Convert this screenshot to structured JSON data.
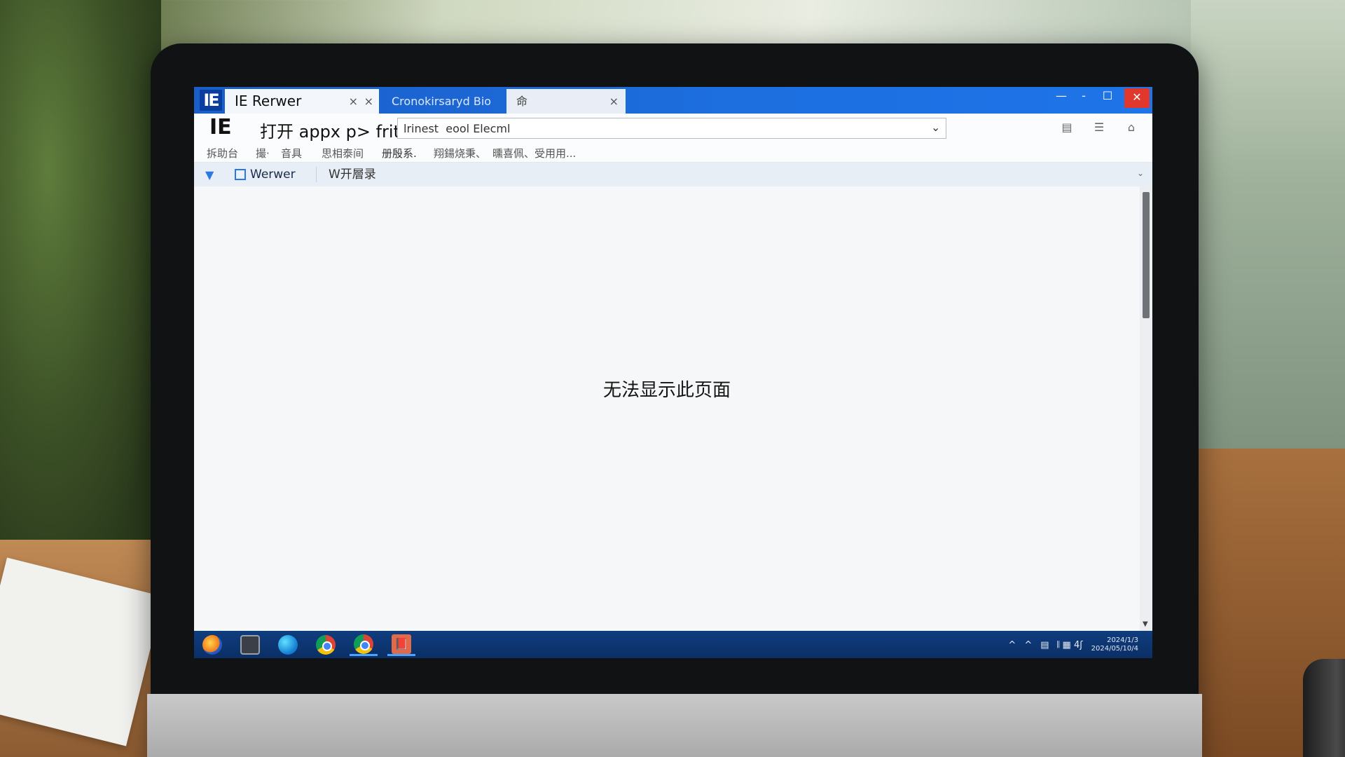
{
  "browser": {
    "badge": "IE",
    "tabs": [
      {
        "label": "IE Rerwer",
        "close_a": "×",
        "close_b": "×"
      },
      {
        "label": "Cronokirsaryd Bio"
      },
      {
        "label": "命",
        "close": "×"
      }
    ],
    "window_controls": {
      "minimize": "—",
      "pin": "-",
      "maximize": "☐",
      "close": "✕"
    }
  },
  "addressbar": {
    "logo": "IE",
    "prefix": "打开 appx p>  frit",
    "url": "lrinest  eool Elecml",
    "dropdown": "⌄"
  },
  "toolbar_icons": [
    "page-icon",
    "tools-icon",
    "home-icon"
  ],
  "menu": [
    {
      "label": "拆助台",
      "active": false
    },
    {
      "label": "撮·",
      "active": false
    },
    {
      "label": "音具",
      "active": false
    },
    {
      "label": "思相泰间",
      "active": false
    },
    {
      "label": "册殷系.",
      "active": true
    },
    {
      "label": "翔鍚烧秉、",
      "active": false
    },
    {
      "label": "曛喜佩、受用用...",
      "active": false
    }
  ],
  "favorites": {
    "item1": "Werwer",
    "item2": "W开層录"
  },
  "content": {
    "error_message": "无法显示此页面"
  },
  "taskbar": {
    "apps": [
      "firefox-icon",
      "file-explorer-icon",
      "edge-icon",
      "chrome-icon",
      "chrome-icon",
      "office-icon"
    ],
    "office_glyph": "📕",
    "tray": {
      "up_a": "^",
      "up_b": "^",
      "net": "▤",
      "vol": "𝄃 ▦ 4ʃ",
      "clock_line1": "2024/1/3",
      "clock_line2": "2024/05/10/4"
    }
  }
}
